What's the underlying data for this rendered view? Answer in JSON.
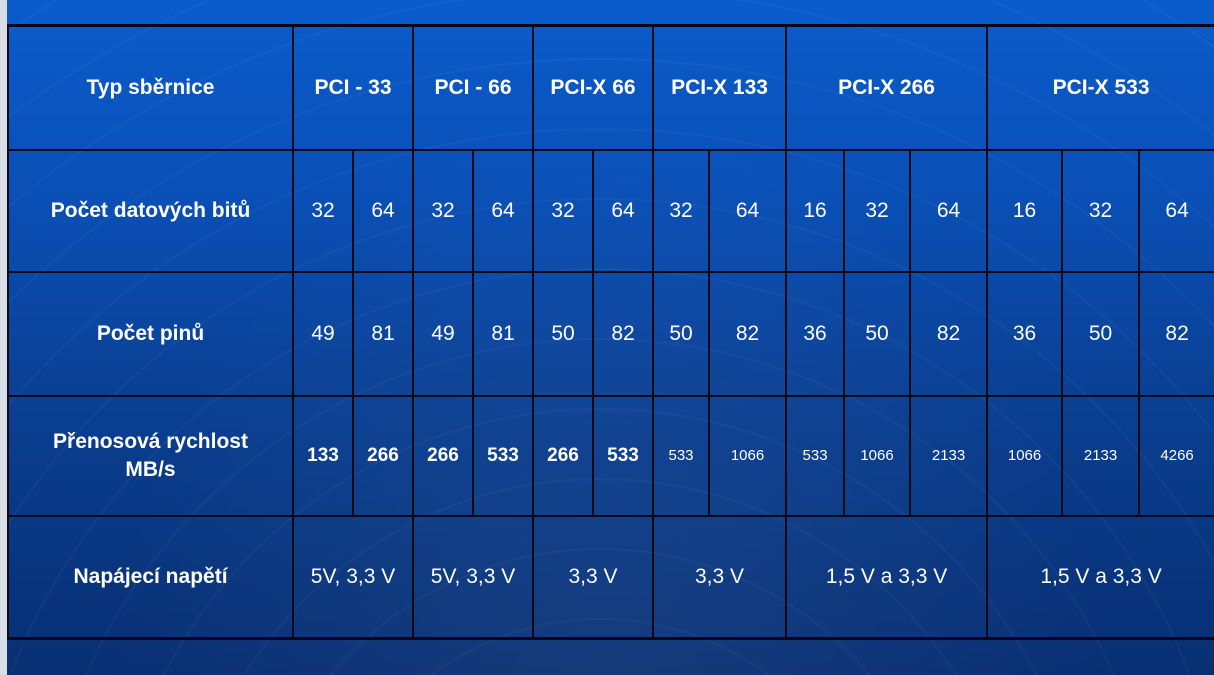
{
  "table": {
    "header": {
      "label": "Typ sběrnice",
      "buses": [
        "PCI - 33",
        "PCI - 66",
        "PCI-X 66",
        "PCI-X 133",
        "PCI-X 266",
        "PCI-X 533"
      ]
    },
    "bits": {
      "label": "Počet datových bitů",
      "values": [
        "32",
        "64",
        "32",
        "64",
        "32",
        "64",
        "32",
        "64",
        "16",
        "32",
        "64",
        "16",
        "32",
        "64"
      ]
    },
    "pins": {
      "label": "Počet pinů",
      "values": [
        "49",
        "81",
        "49",
        "81",
        "50",
        "82",
        "50",
        "82",
        "36",
        "50",
        "82",
        "36",
        "50",
        "82"
      ]
    },
    "rate": {
      "label_line1": "Přenosová rychlost",
      "label_line2": "MB/s",
      "values": [
        "133",
        "266",
        "266",
        "533",
        "266",
        "533",
        "533",
        "1066",
        "533",
        "1066",
        "2133",
        "1066",
        "2133",
        "4266"
      ]
    },
    "voltage": {
      "label": "Napájecí napětí",
      "values": [
        "5V, 3,3 V",
        "5V, 3,3 V",
        "3,3 V",
        "3,3 V",
        "1,5 V a 3,3 V",
        "1,5 V a 3,3 V"
      ]
    }
  }
}
